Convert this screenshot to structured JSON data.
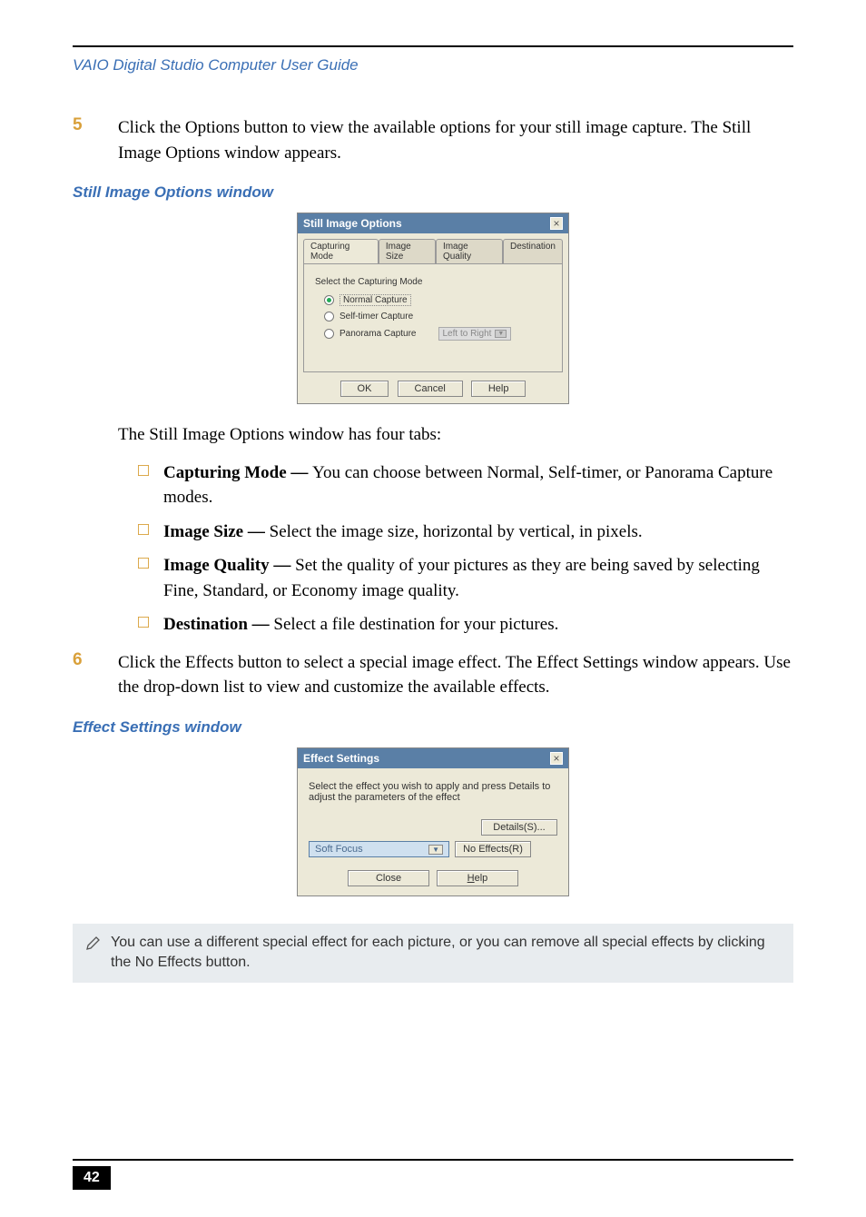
{
  "header": "VAIO Digital Studio Computer User Guide",
  "step5": {
    "num": "5",
    "text": "Click the Options button to view the available options for your still image capture. The Still Image Options window appears."
  },
  "caption1": "Still Image Options window",
  "dlg1": {
    "title": "Still Image Options",
    "tabs": {
      "t1": "Capturing Mode",
      "t2": "Image Size",
      "t3": "Image Quality",
      "t4": "Destination"
    },
    "panel_label": "Select the Capturing Mode",
    "r1": "Normal Capture",
    "r2": "Self-timer Capture",
    "r3": "Panorama Capture",
    "pan_select": "Left to Right",
    "ok": "OK",
    "cancel": "Cancel",
    "help": "Help"
  },
  "para1": "The Still Image Options window has four tabs:",
  "bul": {
    "b1_bold": "Capturing Mode — ",
    "b1_rest": "You can choose between Normal, Self-timer, or Panorama Capture modes.",
    "b2_bold": "Image Size — ",
    "b2_rest": "Select the image size, horizontal by vertical, in pixels.",
    "b3_bold": "Image Quality — ",
    "b3_rest": "Set the quality of your pictures as they are being saved by selecting Fine, Standard, or Economy image quality.",
    "b4_bold": "Destination — ",
    "b4_rest": "Select a file destination for your pictures."
  },
  "step6": {
    "num": "6",
    "text": "Click the Effects button to select a special image effect. The Effect Settings window appears. Use the drop-down list to view and customize the available effects."
  },
  "caption2": "Effect Settings window",
  "dlg2": {
    "title": "Effect Settings",
    "body": "Select the effect you wish to apply and press Details to adjust the parameters of the effect",
    "details": "Details(S)...",
    "select": "Soft Focus",
    "noeff": "No Effects(R)",
    "close": "Close",
    "help": "Help"
  },
  "note": "You can use a different special effect for each picture, or you can remove all special effects by clicking the No Effects button.",
  "pagenum": "42"
}
